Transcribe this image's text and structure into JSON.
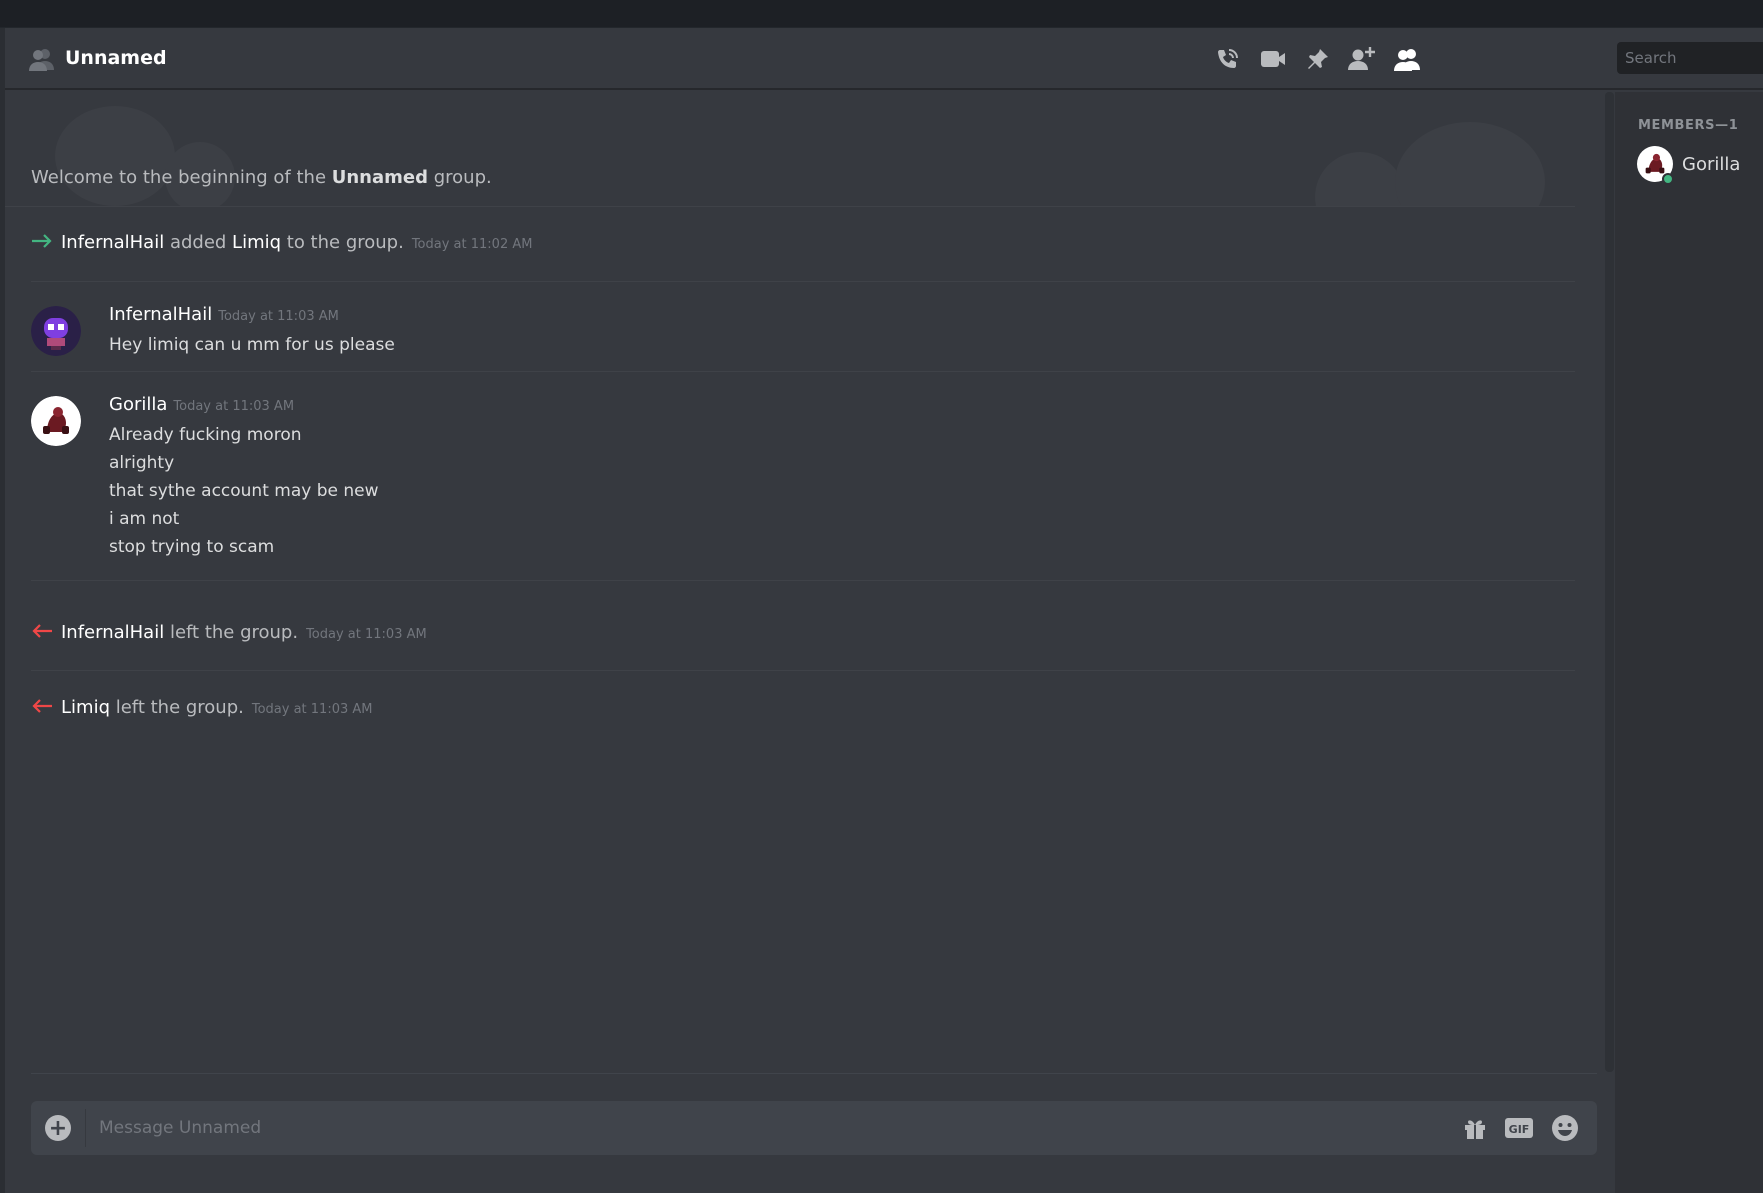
{
  "header": {
    "title": "Unnamed",
    "search_placeholder": "Search",
    "icons": [
      "group-icon",
      "start-voice-call-icon",
      "start-video-call-icon",
      "pinned-messages-icon",
      "add-friends-to-dm-icon",
      "member-list-icon"
    ]
  },
  "welcome": {
    "prefix": "Welcome to the beginning of the ",
    "group_name": "Unnamed",
    "suffix": " group."
  },
  "events": {
    "added": {
      "actor": "InfernalHail",
      "verb": " added ",
      "target": "Limiq",
      "rest": " to the group.",
      "timestamp": "Today at 11:02 AM"
    },
    "left1": {
      "actor": "InfernalHail",
      "rest": " left the group.",
      "timestamp": "Today at 11:03 AM"
    },
    "left2": {
      "actor": "Limiq",
      "rest": " left the group.",
      "timestamp": "Today at 11:03 AM"
    }
  },
  "messages": [
    {
      "author": "InfernalHail",
      "timestamp": "Today at 11:03 AM",
      "lines": [
        "Hey limiq can u mm for us please"
      ]
    },
    {
      "author": "Gorilla",
      "timestamp": "Today at 11:03 AM",
      "lines": [
        "Already fucking moron",
        "alrighty",
        "that sythe account may be new",
        "i am not",
        "stop trying to scam"
      ]
    }
  ],
  "composer": {
    "placeholder": "Message Unnamed",
    "icons": [
      "add-attachment-icon",
      "gift-icon",
      "gif-icon",
      "emoji-icon"
    ]
  },
  "members": {
    "heading": "MEMBERS—1",
    "list": [
      {
        "name": "Gorilla",
        "status": "online",
        "owner": true
      }
    ]
  },
  "colors": {
    "background": "#36393f",
    "sidebar": "#2f3136",
    "join_arrow": "#43b581",
    "leave_arrow": "#f04747",
    "online": "#43b581",
    "crown": "#faa61a"
  }
}
